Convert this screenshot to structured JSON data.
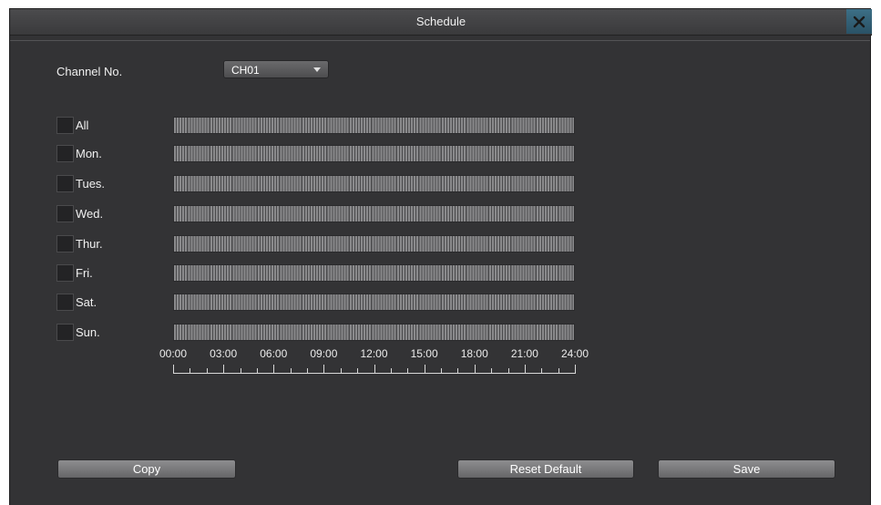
{
  "window": {
    "title": "Schedule",
    "close_icon": "close-icon"
  },
  "channel": {
    "label": "Channel No.",
    "selected": "CH01"
  },
  "days": [
    {
      "label": "All",
      "checked": false
    },
    {
      "label": "Mon.",
      "checked": false
    },
    {
      "label": "Tues.",
      "checked": false
    },
    {
      "label": "Wed.",
      "checked": false
    },
    {
      "label": "Thur.",
      "checked": false
    },
    {
      "label": "Fri.",
      "checked": false
    },
    {
      "label": "Sat.",
      "checked": false
    },
    {
      "label": "Sun.",
      "checked": false
    }
  ],
  "timeline": {
    "labels": [
      "00:00",
      "03:00",
      "06:00",
      "09:00",
      "12:00",
      "15:00",
      "18:00",
      "21:00",
      "24:00"
    ]
  },
  "buttons": {
    "copy": "Copy",
    "reset": "Reset Default",
    "save": "Save"
  },
  "colors": {
    "background": "#333335",
    "accent": "#2a5266"
  }
}
